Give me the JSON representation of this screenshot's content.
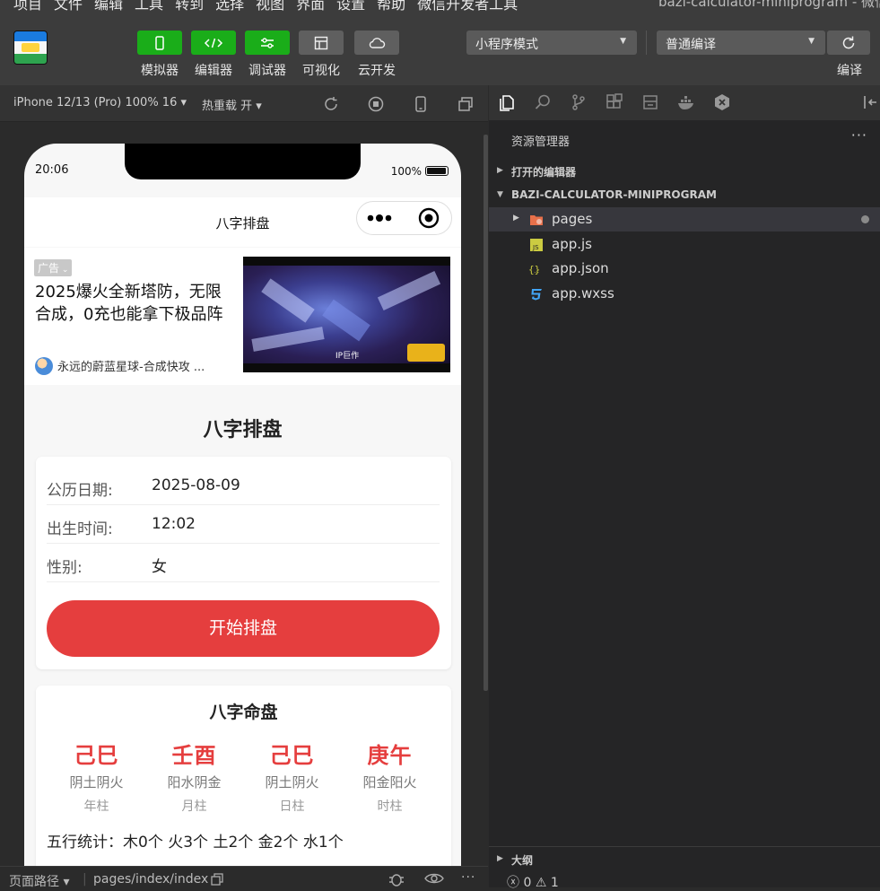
{
  "menubar": {
    "items": [
      "项目",
      "文件",
      "编辑",
      "工具",
      "转到",
      "选择",
      "视图",
      "界面",
      "设置",
      "帮助",
      "微信开发者工具"
    ],
    "window_title": "bazi-calculator-miniprogram - 微信"
  },
  "toolbar": {
    "buttons": [
      {
        "label": "模拟器",
        "icon": "phone-icon"
      },
      {
        "label": "编辑器",
        "icon": "code-icon"
      },
      {
        "label": "调试器",
        "icon": "debug-sliders-icon"
      },
      {
        "label": "可视化",
        "icon": "layout-icon"
      },
      {
        "label": "云开发",
        "icon": "cloud-icon"
      }
    ],
    "mode_select": "小程序模式",
    "compile_select": "普通编译",
    "compile_label": "编译"
  },
  "simbar": {
    "device": "iPhone 12/13 (Pro) 100% 16",
    "hot_reload": "热重载 开"
  },
  "phone": {
    "time": "20:06",
    "battery": "100%",
    "nav_title": "八字排盘",
    "ad": {
      "tag": "广告",
      "title": "2025爆火全新塔防，无限合成，0充也能拿下极品阵",
      "source": "永远的蔚蓝星球-合成快攻 ...",
      "image_caption": "IP巨作"
    },
    "page_title": "八字排盘",
    "form": {
      "rows": [
        {
          "label": "公历日期:",
          "value": "2025-08-09"
        },
        {
          "label": "出生时间:",
          "value": "12:02"
        },
        {
          "label": "性别:",
          "value": "女"
        }
      ],
      "start_button": "开始排盘"
    },
    "chart": {
      "title": "八字命盘",
      "pillars": [
        {
          "ganzhi": "己巳",
          "wuxing": "阴土阴火",
          "name": "年柱"
        },
        {
          "ganzhi": "壬酉",
          "wuxing": "阳水阴金",
          "name": "月柱"
        },
        {
          "ganzhi": "己巳",
          "wuxing": "阴土阴火",
          "name": "日柱"
        },
        {
          "ganzhi": "庚午",
          "wuxing": "阳金阳火",
          "name": "时柱"
        }
      ],
      "wuxing_stats": "五行统计：木0个 火3个 土2个 金2个 水1个"
    }
  },
  "explorer": {
    "title": "资源管理器",
    "more": "···",
    "open_editors": "打开的编辑器",
    "project": "BAZI-CALCULATOR-MINIPROGRAM",
    "files": [
      {
        "name": "pages",
        "icon": "folder-icon"
      },
      {
        "name": "app.js",
        "icon": "js-file-icon"
      },
      {
        "name": "app.json",
        "icon": "json-file-icon"
      },
      {
        "name": "app.wxss",
        "icon": "css-file-icon"
      }
    ],
    "outline": "大纲",
    "errors": "0",
    "warnings": "1"
  },
  "bottombar": {
    "path_label": "页面路径",
    "path": "pages/index/index"
  },
  "colors": {
    "accent_green": "#1aad19",
    "primary_red": "#e53e3e",
    "panel_bg": "#252526"
  }
}
